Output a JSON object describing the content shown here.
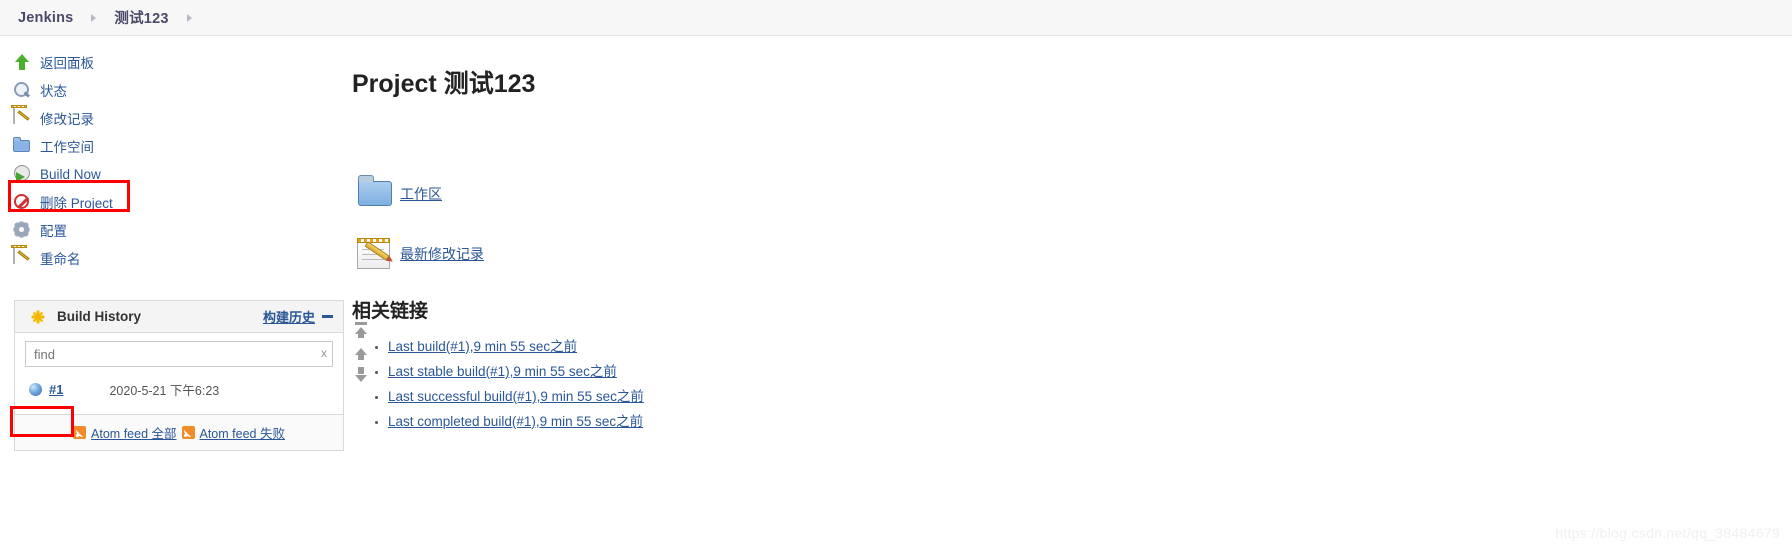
{
  "breadcrumb": {
    "items": [
      {
        "label": "Jenkins"
      },
      {
        "label": "测试123"
      }
    ]
  },
  "sidebar": {
    "tasks": [
      {
        "label": "返回面板",
        "icon": "up-arrow-icon"
      },
      {
        "label": "状态",
        "icon": "magnifier-icon"
      },
      {
        "label": "修改记录",
        "icon": "notepad-pencil-icon"
      },
      {
        "label": "工作空间",
        "icon": "folder-icon"
      },
      {
        "label": "Build Now",
        "icon": "clock-play-icon"
      },
      {
        "label": "删除 Project",
        "icon": "no-entry-icon"
      },
      {
        "label": "配置",
        "icon": "gear-icon"
      },
      {
        "label": "重命名",
        "icon": "notepad-pencil-icon"
      }
    ],
    "build_history": {
      "title": "Build History",
      "link_label": "构建历史",
      "collapse_label": "—",
      "find_placeholder": "find",
      "find_value": "",
      "clear_label": "x",
      "builds": [
        {
          "number": "#1",
          "timestamp": "2020-5-21 下午6:23",
          "status": "blue"
        }
      ],
      "feeds": [
        {
          "label": "Atom feed 全部"
        },
        {
          "label": "Atom feed 失败"
        }
      ]
    }
  },
  "main": {
    "title": "Project 测试123",
    "shortcuts": [
      {
        "label": "工作区",
        "icon": "folder-icon"
      },
      {
        "label": "最新修改记录",
        "icon": "notepad-pencil-icon"
      }
    ],
    "related_links_title": "相关链接",
    "related_links": [
      {
        "label": "Last build(#1),9 min 55 sec之前"
      },
      {
        "label": "Last stable build(#1),9 min 55 sec之前"
      },
      {
        "label": "Last successful build(#1),9 min 55 sec之前"
      },
      {
        "label": "Last completed build(#1),9 min 55 sec之前"
      }
    ]
  },
  "watermark": "https://blog.csdn.net/qq_38484679",
  "colors": {
    "link": "#2b5797",
    "annotation": "#ff0000",
    "header_bg": "#f7f7f7"
  }
}
